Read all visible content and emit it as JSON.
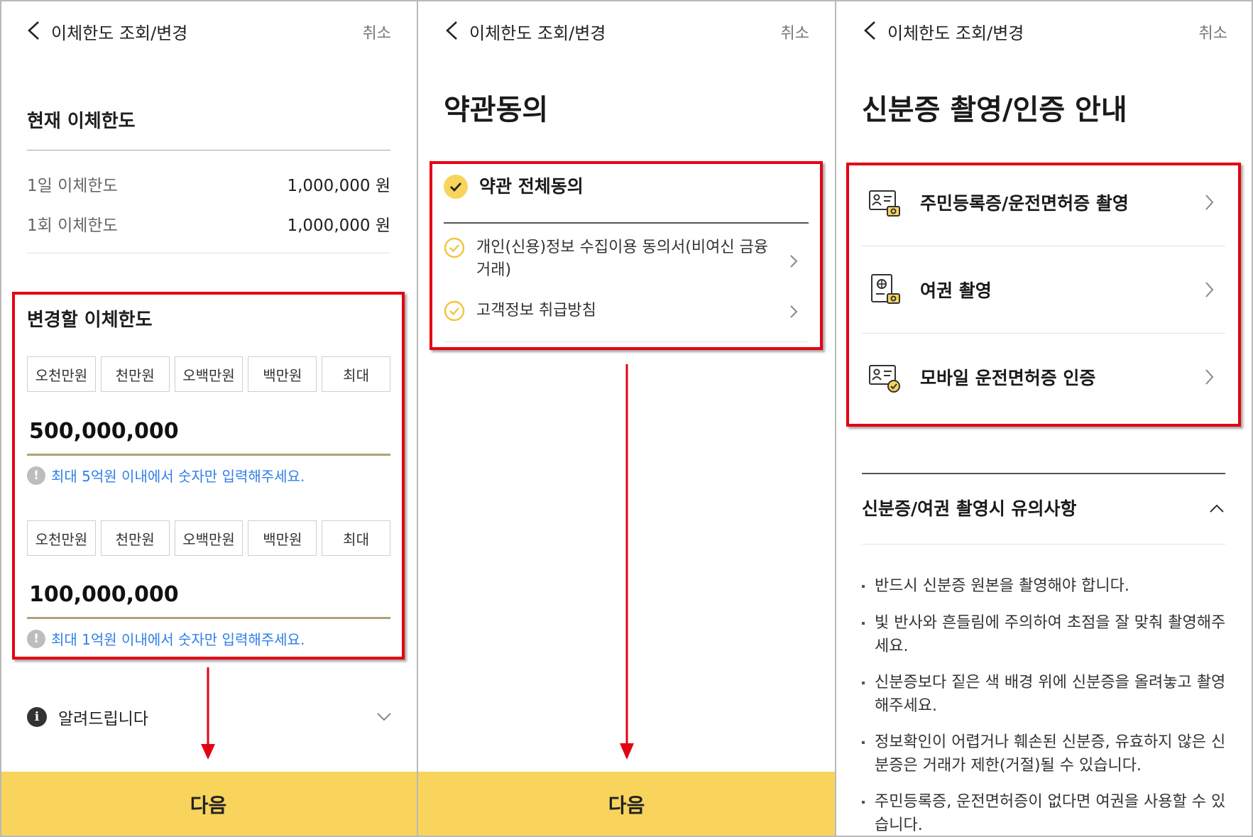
{
  "header": {
    "title": "이체한도 조회/변경",
    "cancel": "취소"
  },
  "screen1": {
    "current_title": "현재 이체한도",
    "limits": [
      {
        "label": "1일 이체한도",
        "value": "1,000,000 원"
      },
      {
        "label": "1회 이체한도",
        "value": "1,000,000 원"
      }
    ],
    "change_title": "변경할 이체한도",
    "chips_daily": [
      "오천만원",
      "천만원",
      "오백만원",
      "백만원",
      "최대"
    ],
    "daily_amount": "500,000,000",
    "daily_hint": "최대 5억원 이내에서 숫자만 입력해주세요.",
    "chips_once": [
      "오천만원",
      "천만원",
      "오백만원",
      "백만원",
      "최대"
    ],
    "once_amount": "100,000,000",
    "once_hint": "최대 1억원 이내에서 숫자만 입력해주세요.",
    "notice": "알려드립니다",
    "next": "다음"
  },
  "screen2": {
    "title": "약관동의",
    "agree_all": "약관 전체동의",
    "terms": [
      "개인(신용)정보 수집이용 동의서(비여신 금융거래)",
      "고객정보 취급방침"
    ],
    "next": "다음"
  },
  "screen3": {
    "title": "신분증 촬영/인증 안내",
    "items": [
      {
        "label": "주민등록증/운전면허증 촬영",
        "icon": "id-card-camera-icon"
      },
      {
        "label": "여권 촬영",
        "icon": "passport-camera-icon"
      },
      {
        "label": "모바일 운전면허증 인증",
        "icon": "mobile-license-check-icon"
      }
    ],
    "caution_title": "신분증/여권 촬영시 유의사항",
    "cautions": [
      "반드시 신분증 원본을 촬영해야 합니다.",
      "빛 반사와 흔들림에 주의하여 초점을 잘 맞춰 촬영해주세요.",
      "신분증보다 짙은 색 배경 위에 신분증을 올려놓고 촬영해주세요.",
      "정보확인이 어렵거나 훼손된 신분증, 유효하지 않은 신분증은 거래가 제한(거절)될 수 있습니다.",
      "주민등록증, 운전면허증이 없다면 여권을 사용할 수 있습니다."
    ]
  },
  "colors": {
    "accent": "#f8d45c",
    "highlight": "#e50012",
    "hint": "#2f7fe6",
    "underline": "#b1a07a"
  }
}
